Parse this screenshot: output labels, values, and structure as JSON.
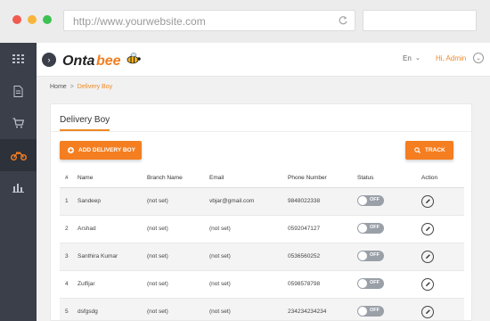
{
  "browser": {
    "url": "http://www.yourwebsite.com"
  },
  "sidebar": {
    "items": [
      {
        "icon": "grid-icon",
        "active": false
      },
      {
        "icon": "document-icon",
        "active": false
      },
      {
        "icon": "cart-icon",
        "active": false
      },
      {
        "icon": "motorbike-icon",
        "active": true
      },
      {
        "icon": "bar-chart-icon",
        "active": false
      }
    ]
  },
  "header": {
    "logo_text": "Ontabee",
    "language": "En",
    "greeting": "Hi, Admin"
  },
  "breadcrumb": {
    "home": "Home",
    "separator": ">",
    "current": "Delivery Boy"
  },
  "panel": {
    "title": "Delivery Boy",
    "add_button": "ADD DELIVERY BOY",
    "track_button": "TRACK"
  },
  "table": {
    "headers": {
      "num": "#",
      "name": "Name",
      "branch": "Branch Name",
      "email": "Email",
      "phone": "Phone Number",
      "status": "Status",
      "action": "Action"
    },
    "rows": [
      {
        "num": "1",
        "name": "Sandeep",
        "branch": "(not set)",
        "email": "vbjar@gmail.com",
        "phone": "9848022338",
        "status": "OFF"
      },
      {
        "num": "2",
        "name": "Arshad",
        "branch": "(not set)",
        "email": "(not set)",
        "phone": "0592047127",
        "status": "OFF"
      },
      {
        "num": "3",
        "name": "Santhira Kumar",
        "branch": "(not set)",
        "email": "(not set)",
        "phone": "0536560252",
        "status": "OFF"
      },
      {
        "num": "4",
        "name": "Zulfijar",
        "branch": "(not set)",
        "email": "(not set)",
        "phone": "0598578798",
        "status": "OFF"
      },
      {
        "num": "5",
        "name": "dsfgsdg",
        "branch": "(not set)",
        "email": "(not set)",
        "phone": "234234234234",
        "status": "OFF"
      }
    ]
  },
  "colors": {
    "accent": "#f47e20",
    "sidebar_bg": "#3a3f4a",
    "toggle_off": "#9aa0a8"
  }
}
